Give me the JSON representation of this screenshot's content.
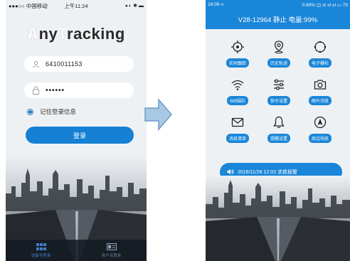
{
  "login_screen": {
    "status_bar": {
      "carrier": "●●●○○ 中国移动",
      "time": "上午11:24",
      "indicators": "◂ ◐ ✱ ▬"
    },
    "logo": {
      "part1": "A",
      "part2": "ny",
      "part3": "T",
      "part4": "racking"
    },
    "username": {
      "value": "6410011153",
      "icon": "user-icon"
    },
    "password": {
      "value": "••••••",
      "icon": "lock-icon"
    },
    "remember_label": "记住登录信息",
    "login_button": "登录",
    "bottom_tabs": [
      {
        "label": "设备号登录",
        "icon": "grid-icon",
        "active": true
      },
      {
        "label": "用户名登录",
        "icon": "id-card-icon",
        "active": false
      }
    ]
  },
  "device_screen": {
    "status_bar": {
      "time": "16:08 ∞",
      "indicators": "0.60% ◫ ⊘ ııl ııl ▭ 75"
    },
    "header_title": "V28-12964 静止 电量:99%",
    "functions": [
      {
        "label": "实时跟踪",
        "icon": "crosshair-icon"
      },
      {
        "label": "历史轨迹",
        "icon": "location-pin-icon"
      },
      {
        "label": "电子栅栏",
        "icon": "circle-fence-icon"
      },
      {
        "label": "Wifi围栏",
        "icon": "wifi-icon"
      },
      {
        "label": "指令设置",
        "icon": "sliders-icon"
      },
      {
        "label": "图片浏览",
        "icon": "camera-icon"
      },
      {
        "label": "消息清单",
        "icon": "mail-icon"
      },
      {
        "label": "提醒设置",
        "icon": "bell-icon"
      },
      {
        "label": "周边导航",
        "icon": "navigation-icon"
      }
    ],
    "alarm": {
      "icon": "speaker-icon",
      "text": "2016/11/28 12:03 求救报警"
    }
  },
  "colors": {
    "accent": "#1a86d9",
    "button": "#1580d4",
    "background": "#eef1f4"
  }
}
